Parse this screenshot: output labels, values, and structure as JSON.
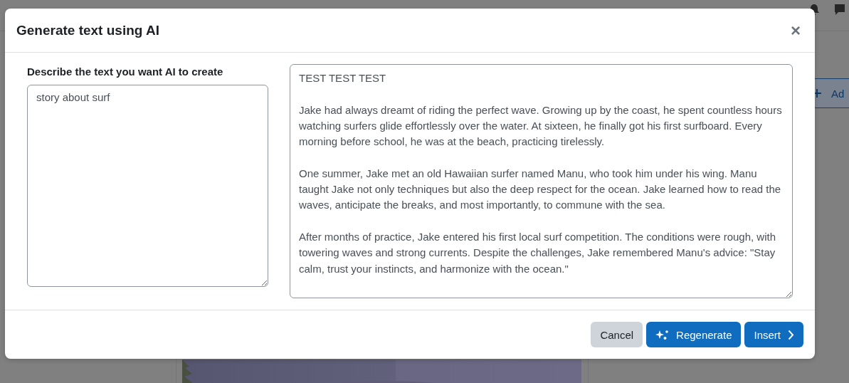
{
  "background": {
    "add_button": {
      "label": "Ad"
    }
  },
  "dialog": {
    "title": "Generate text using AI",
    "close": "×",
    "prompt": {
      "label": "Describe the text you want AI to create",
      "value": "story about surf"
    },
    "output": {
      "paragraphs": [
        "TEST TEST TEST",
        "Jake had always dreamt of riding the perfect wave. Growing up by the coast, he spent countless hours watching surfers glide effortlessly over the water. At sixteen, he finally got his first surfboard. Every morning before school, he was at the beach, practicing tirelessly.",
        "One summer, Jake met an old Hawaiian surfer named Manu, who took him under his wing. Manu taught Jake not only techniques but also the deep respect for the ocean. Jake learned how to read the waves, anticipate the breaks, and most importantly, to commune with the sea.",
        "After months of practice, Jake entered his first local surf competition. The conditions were rough, with towering waves and strong currents. Despite the challenges, Jake remembered Manu's advice: \"Stay calm, trust your instincts, and harmonize with the ocean.\""
      ]
    },
    "buttons": [
      {
        "label": "Cancel",
        "kind": "secondary"
      },
      {
        "label": "Regenerate",
        "kind": "regenerate"
      },
      {
        "label": "Insert",
        "kind": "insert"
      }
    ]
  }
}
